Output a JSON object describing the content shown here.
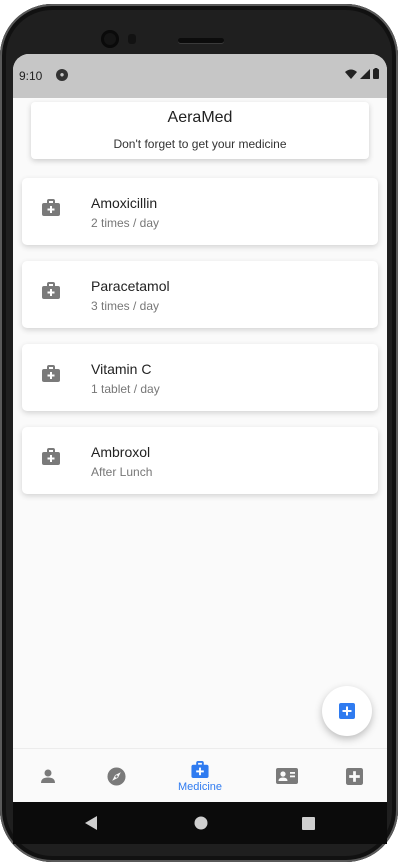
{
  "status_bar": {
    "time": "9:10",
    "app_icon": "app-notification-icon"
  },
  "header": {
    "title": "AeraMed",
    "subtitle": "Don't forget to get your medicine"
  },
  "medicines": [
    {
      "name": "Amoxicillin",
      "dose": "2 times / day"
    },
    {
      "name": "Paracetamol",
      "dose": "3 times / day"
    },
    {
      "name": "Vitamin C",
      "dose": "1 tablet / day"
    },
    {
      "name": "Ambroxol",
      "dose": "After Lunch"
    }
  ],
  "bottom_nav": {
    "items": [
      {
        "icon": "person-icon",
        "label": ""
      },
      {
        "icon": "compass-icon",
        "label": ""
      },
      {
        "icon": "medical-bag-icon",
        "label": "Medicine",
        "active": true
      },
      {
        "icon": "contact-card-icon",
        "label": ""
      },
      {
        "icon": "medical-plus-icon",
        "label": ""
      }
    ]
  },
  "colors": {
    "accent": "#2f7bf0",
    "icon_gray": "#7a7a7a",
    "background": "#fafafa",
    "status_bar": "#c6c6c6"
  }
}
